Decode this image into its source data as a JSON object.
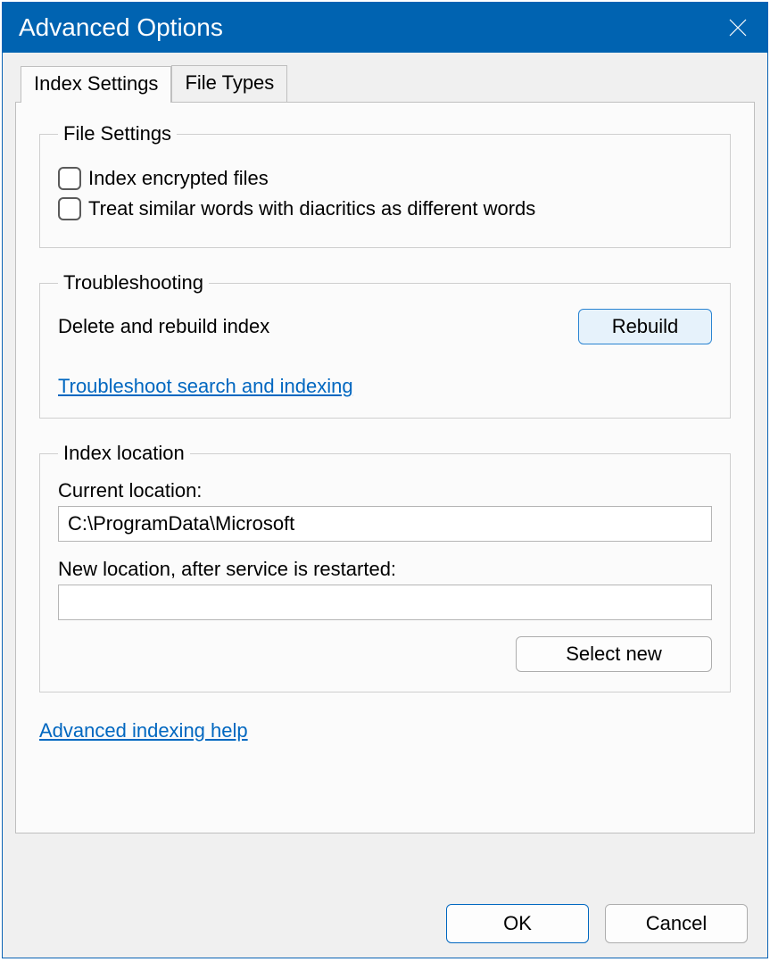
{
  "window": {
    "title": "Advanced Options"
  },
  "tabs": {
    "index_settings": "Index Settings",
    "file_types": "File Types"
  },
  "file_settings": {
    "legend": "File Settings",
    "index_encrypted": "Index encrypted files",
    "diacritics": "Treat similar words with diacritics as different words"
  },
  "troubleshooting": {
    "legend": "Troubleshooting",
    "delete_rebuild": "Delete and rebuild index",
    "rebuild_button": "Rebuild",
    "troubleshoot_link": "Troubleshoot search and indexing"
  },
  "index_location": {
    "legend": "Index location",
    "current_label": "Current location:",
    "current_value": "C:\\ProgramData\\Microsoft",
    "new_label": "New location, after service is restarted:",
    "new_value": "",
    "select_new": "Select new"
  },
  "help_link": "Advanced indexing help",
  "buttons": {
    "ok": "OK",
    "cancel": "Cancel"
  }
}
